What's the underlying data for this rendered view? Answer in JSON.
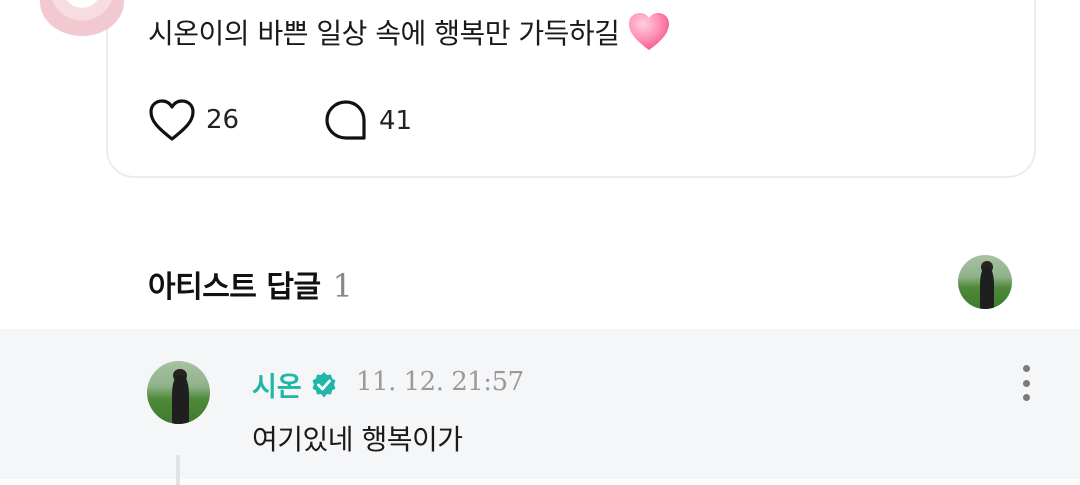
{
  "post": {
    "text": "시온이의 바쁜 일상 속에 행복만 가득하길",
    "emoji": "pink-heart-emoji",
    "like_count": "26",
    "comment_count": "41"
  },
  "artist_replies": {
    "title": "아티스트 답글",
    "count": "1"
  },
  "reply": {
    "author": "시온",
    "verified": true,
    "timestamp": "11. 12. 21:57",
    "text": "여기있네 행복이가"
  },
  "colors": {
    "accent": "#21b7a8",
    "reply_bg": "#f5f6f8",
    "heart": "#ff7fa8"
  }
}
